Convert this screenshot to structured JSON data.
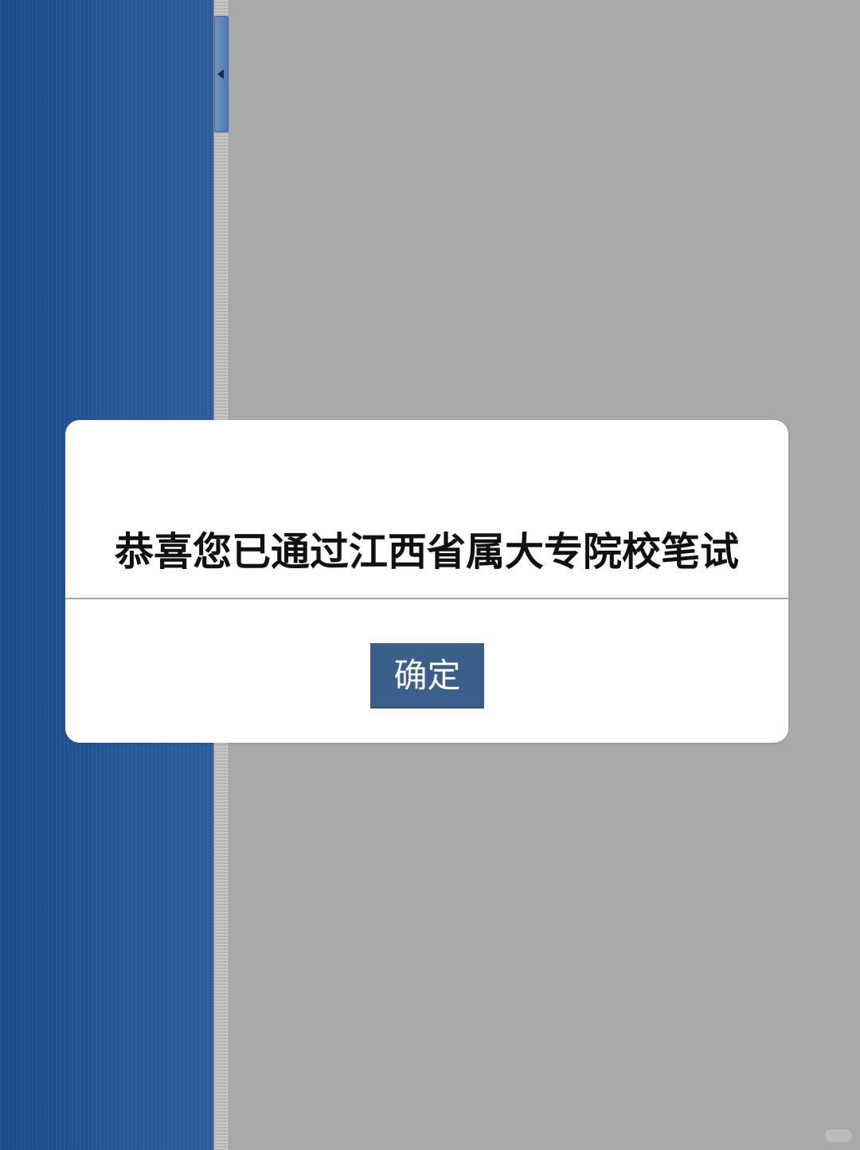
{
  "dialog": {
    "message": "恭喜您已通过江西省属大专院校笔试",
    "confirm_label": "确定"
  },
  "colors": {
    "left_panel": "#245596",
    "background": "#a9a9a9",
    "button": "#3a5f8a"
  }
}
